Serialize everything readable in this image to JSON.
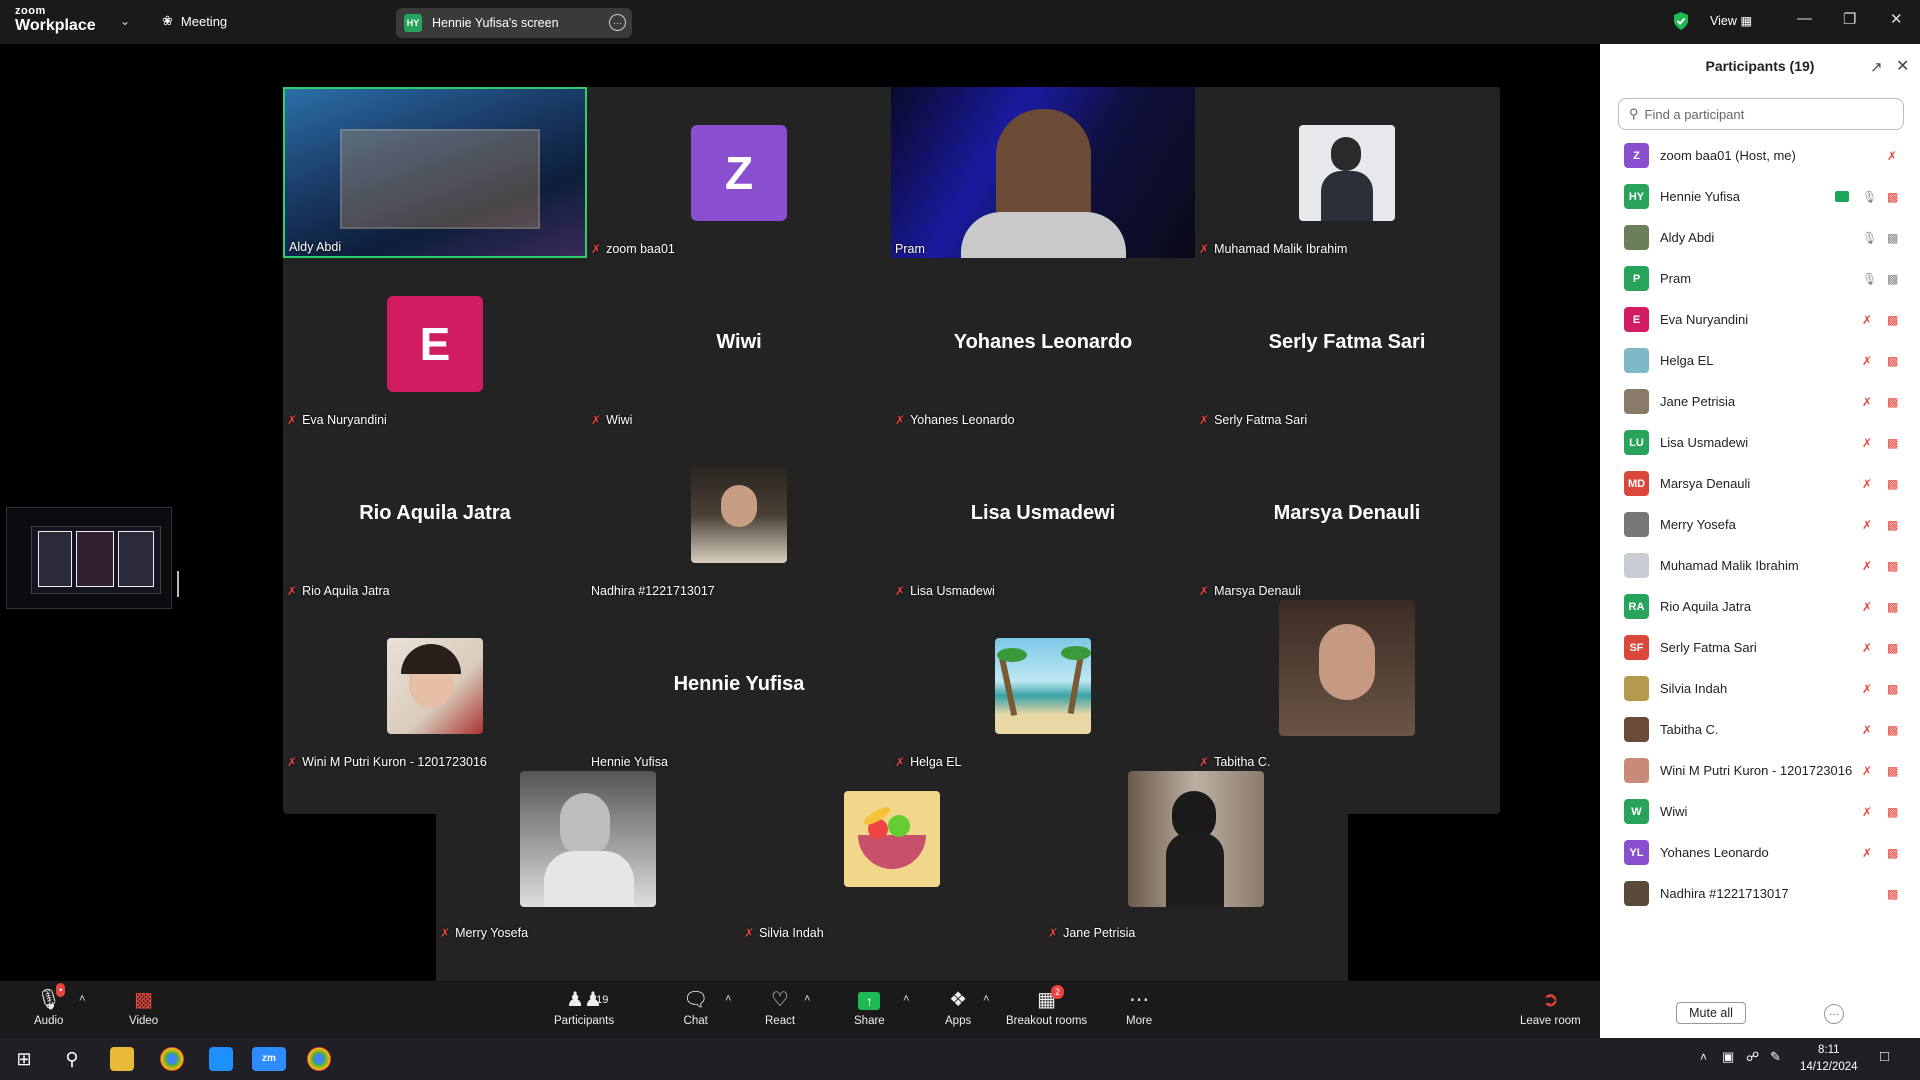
{
  "app": {
    "brand_top": "zoom",
    "brand_bottom": "Workplace",
    "meeting_label": "Meeting",
    "screen_share_initials": "HY",
    "screen_share_label": "Hennie Yufisa's screen",
    "view_label": "View"
  },
  "tiles": [
    {
      "name": "Aldy Abdi",
      "muted": false,
      "kind": "video-room",
      "active": true
    },
    {
      "name": "zoom baa01",
      "muted": true,
      "kind": "avatar",
      "initial": "Z",
      "color": "#8a4fcf"
    },
    {
      "name": "Pram",
      "muted": false,
      "kind": "video-person"
    },
    {
      "name": "Muhamad Malik Ibrahim",
      "muted": true,
      "kind": "photo"
    },
    {
      "name": "Eva Nuryandini",
      "muted": true,
      "kind": "avatar",
      "initial": "E",
      "color": "#d11c61"
    },
    {
      "name": "Wiwi",
      "muted": true,
      "kind": "text",
      "big": "Wiwi"
    },
    {
      "name": "Yohanes Leonardo",
      "muted": true,
      "kind": "text",
      "big": "Yohanes Leonardo"
    },
    {
      "name": "Serly Fatma Sari",
      "muted": true,
      "kind": "text",
      "big": "Serly Fatma Sari"
    },
    {
      "name": "Rio Aquila Jatra",
      "muted": true,
      "kind": "text",
      "big": "Rio Aquila Jatra"
    },
    {
      "name": "Nadhira #1221713017",
      "muted": false,
      "kind": "photo"
    },
    {
      "name": "Lisa Usmadewi",
      "muted": true,
      "kind": "text",
      "big": "Lisa Usmadewi"
    },
    {
      "name": "Marsya Denauli",
      "muted": true,
      "kind": "text",
      "big": "Marsya Denauli"
    },
    {
      "name": "Wini M Putri Kuron - 1201723016",
      "muted": true,
      "kind": "photo"
    },
    {
      "name": "Hennie Yufisa",
      "muted": false,
      "kind": "text",
      "big": "Hennie Yufisa"
    },
    {
      "name": "Helga EL",
      "muted": true,
      "kind": "photo-beach"
    },
    {
      "name": "Tabitha C.",
      "muted": true,
      "kind": "photo-large"
    },
    {
      "name": "Merry Yosefa",
      "muted": true,
      "kind": "photo-large"
    },
    {
      "name": "Silvia Indah",
      "muted": true,
      "kind": "photo-fruit"
    },
    {
      "name": "Jane Petrisia",
      "muted": true,
      "kind": "photo-large"
    }
  ],
  "panel": {
    "title": "Participants (19)",
    "search_placeholder": "Find a participant",
    "mute_all": "Mute all",
    "participants": [
      {
        "name": "zoom baa01 (Host, me)",
        "initials": "Z",
        "color": "#8a4fcf",
        "mic": "muted",
        "cam": "none"
      },
      {
        "name": "Hennie Yufisa",
        "initials": "HY",
        "color": "#27a35b",
        "mic": "muted-grey",
        "cam": "off",
        "sharing": true
      },
      {
        "name": "Aldy Abdi",
        "initials": "",
        "color": "#6b7f5a",
        "mic": "on",
        "cam": "on"
      },
      {
        "name": "Pram",
        "initials": "P",
        "color": "#27a35b",
        "mic": "on-grey",
        "cam": "on"
      },
      {
        "name": "Eva Nuryandini",
        "initials": "E",
        "color": "#d11c61",
        "mic": "muted",
        "cam": "off"
      },
      {
        "name": "Helga EL",
        "initials": "",
        "color": "#7fb8c9",
        "mic": "muted",
        "cam": "off"
      },
      {
        "name": "Jane Petrisia",
        "initials": "",
        "color": "#8a7a6a",
        "mic": "muted",
        "cam": "off"
      },
      {
        "name": "Lisa Usmadewi",
        "initials": "LU",
        "color": "#27a35b",
        "mic": "muted",
        "cam": "off"
      },
      {
        "name": "Marsya Denauli",
        "initials": "MD",
        "color": "#d9483b",
        "mic": "muted",
        "cam": "off"
      },
      {
        "name": "Merry Yosefa",
        "initials": "",
        "color": "#777777",
        "mic": "muted",
        "cam": "off"
      },
      {
        "name": "Muhamad Malik Ibrahim",
        "initials": "",
        "color": "#c9cdd3",
        "mic": "muted",
        "cam": "off"
      },
      {
        "name": "Rio Aquila Jatra",
        "initials": "RA",
        "color": "#27a35b",
        "mic": "muted",
        "cam": "off"
      },
      {
        "name": "Serly Fatma Sari",
        "initials": "SF",
        "color": "#d9483b",
        "mic": "muted",
        "cam": "off"
      },
      {
        "name": "Silvia Indah",
        "initials": "",
        "color": "#b59a4d",
        "mic": "muted",
        "cam": "off"
      },
      {
        "name": "Tabitha C.",
        "initials": "",
        "color": "#6b4a3a",
        "mic": "muted",
        "cam": "off"
      },
      {
        "name": "Wini M Putri Kuron - 1201723016",
        "initials": "",
        "color": "#c98a7a",
        "mic": "muted",
        "cam": "off"
      },
      {
        "name": "Wiwi",
        "initials": "W",
        "color": "#27a35b",
        "mic": "muted",
        "cam": "off"
      },
      {
        "name": "Yohanes Leonardo",
        "initials": "YL",
        "color": "#8a4fcf",
        "mic": "muted",
        "cam": "off"
      },
      {
        "name": "Nadhira #1221713017",
        "initials": "",
        "color": "#5a4a3a",
        "mic": "none",
        "cam": "off"
      }
    ]
  },
  "toolbar": {
    "audio": "Audio",
    "video": "Video",
    "participants": "Participants",
    "participants_count": "19",
    "chat": "Chat",
    "react": "React",
    "share": "Share",
    "apps": "Apps",
    "breakout": "Breakout rooms",
    "breakout_badge": "2",
    "more": "More",
    "leave": "Leave room"
  },
  "taskbar": {
    "time": "8:11",
    "date": "14/12/2024"
  },
  "colors": {
    "accent_green": "#2ed06a",
    "mute_red": "#e8453c"
  }
}
